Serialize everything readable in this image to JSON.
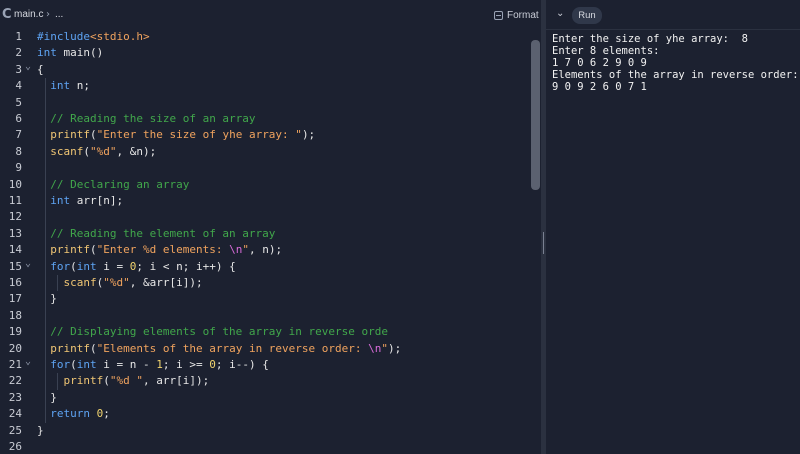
{
  "editor": {
    "file_name": "main.c",
    "crumb_separator": "›",
    "crumb_more": "...",
    "format_label": "Format",
    "lines": [
      {
        "n": "1",
        "fold": "",
        "tokens": [
          [
            "inc",
            "#include"
          ],
          [
            "hdr",
            "<stdio.h>"
          ]
        ]
      },
      {
        "n": "2",
        "fold": "",
        "tokens": [
          [
            "kw",
            "int"
          ],
          [
            "pl",
            " main()"
          ]
        ]
      },
      {
        "n": "3",
        "fold": "v",
        "tokens": [
          [
            "pl",
            "{"
          ]
        ]
      },
      {
        "n": "4",
        "fold": "",
        "tokens": [
          [
            "pl",
            "  "
          ],
          [
            "kw",
            "int"
          ],
          [
            "pl",
            " n;"
          ]
        ]
      },
      {
        "n": "5",
        "fold": "",
        "tokens": []
      },
      {
        "n": "6",
        "fold": "",
        "tokens": [
          [
            "pl",
            "  "
          ],
          [
            "cm",
            "// Reading the size of an array"
          ]
        ]
      },
      {
        "n": "7",
        "fold": "",
        "tokens": [
          [
            "pl",
            "  "
          ],
          [
            "fn",
            "printf"
          ],
          [
            "pl",
            "("
          ],
          [
            "str",
            "\"Enter the size of yhe array: \""
          ],
          [
            "pl",
            ");"
          ]
        ]
      },
      {
        "n": "8",
        "fold": "",
        "tokens": [
          [
            "pl",
            "  "
          ],
          [
            "fn",
            "scanf"
          ],
          [
            "pl",
            "("
          ],
          [
            "str",
            "\"%d\""
          ],
          [
            "pl",
            ", &n);"
          ]
        ]
      },
      {
        "n": "9",
        "fold": "",
        "tokens": []
      },
      {
        "n": "10",
        "fold": "",
        "tokens": [
          [
            "pl",
            "  "
          ],
          [
            "cm",
            "// Declaring an array"
          ]
        ]
      },
      {
        "n": "11",
        "fold": "",
        "tokens": [
          [
            "pl",
            "  "
          ],
          [
            "kw",
            "int"
          ],
          [
            "pl",
            " arr[n];"
          ]
        ]
      },
      {
        "n": "12",
        "fold": "",
        "tokens": []
      },
      {
        "n": "13",
        "fold": "",
        "tokens": [
          [
            "pl",
            "  "
          ],
          [
            "cm",
            "// Reading the element of an array"
          ]
        ]
      },
      {
        "n": "14",
        "fold": "",
        "tokens": [
          [
            "pl",
            "  "
          ],
          [
            "fn",
            "printf"
          ],
          [
            "pl",
            "("
          ],
          [
            "str",
            "\"Enter %d elements: "
          ],
          [
            "esc",
            "\\n"
          ],
          [
            "str",
            "\""
          ],
          [
            "pl",
            ", n);"
          ]
        ]
      },
      {
        "n": "15",
        "fold": "v",
        "tokens": [
          [
            "pl",
            "  "
          ],
          [
            "kw",
            "for"
          ],
          [
            "pl",
            "("
          ],
          [
            "kw",
            "int"
          ],
          [
            "pl",
            " i = "
          ],
          [
            "num",
            "0"
          ],
          [
            "pl",
            "; i < n; i++) {"
          ]
        ]
      },
      {
        "n": "16",
        "fold": "",
        "tokens": [
          [
            "pl",
            "    "
          ],
          [
            "fn",
            "scanf"
          ],
          [
            "pl",
            "("
          ],
          [
            "str",
            "\"%d\""
          ],
          [
            "pl",
            ", &arr[i]);"
          ]
        ]
      },
      {
        "n": "17",
        "fold": "",
        "tokens": [
          [
            "pl",
            "  }"
          ]
        ]
      },
      {
        "n": "18",
        "fold": "",
        "tokens": []
      },
      {
        "n": "19",
        "fold": "",
        "tokens": [
          [
            "pl",
            "  "
          ],
          [
            "cm",
            "// Displaying elements of the array in reverse orde"
          ]
        ]
      },
      {
        "n": "20",
        "fold": "",
        "tokens": [
          [
            "pl",
            "  "
          ],
          [
            "fn",
            "printf"
          ],
          [
            "pl",
            "("
          ],
          [
            "str",
            "\"Elements of the array in reverse order: "
          ],
          [
            "esc",
            "\\n"
          ],
          [
            "str",
            "\""
          ],
          [
            "pl",
            ");"
          ]
        ]
      },
      {
        "n": "21",
        "fold": "v",
        "tokens": [
          [
            "pl",
            "  "
          ],
          [
            "kw",
            "for"
          ],
          [
            "pl",
            "("
          ],
          [
            "kw",
            "int"
          ],
          [
            "pl",
            " i = n - "
          ],
          [
            "num",
            "1"
          ],
          [
            "pl",
            "; i >= "
          ],
          [
            "num",
            "0"
          ],
          [
            "pl",
            "; i--) {"
          ]
        ]
      },
      {
        "n": "22",
        "fold": "",
        "tokens": [
          [
            "pl",
            "    "
          ],
          [
            "fn",
            "printf"
          ],
          [
            "pl",
            "("
          ],
          [
            "str",
            "\"%d \""
          ],
          [
            "pl",
            ", arr[i]);"
          ]
        ]
      },
      {
        "n": "23",
        "fold": "",
        "tokens": [
          [
            "pl",
            "  }"
          ]
        ]
      },
      {
        "n": "24",
        "fold": "",
        "tokens": [
          [
            "pl",
            "  "
          ],
          [
            "kw",
            "return"
          ],
          [
            "pl",
            " "
          ],
          [
            "num",
            "0"
          ],
          [
            "pl",
            ";"
          ]
        ]
      },
      {
        "n": "25",
        "fold": "",
        "tokens": [
          [
            "pl",
            "}"
          ]
        ]
      },
      {
        "n": "26",
        "fold": "",
        "tokens": []
      }
    ]
  },
  "console": {
    "run_label": "Run",
    "output": "Enter the size of yhe array:  8\nEnter 8 elements:\n1 7 0 6 2 9 0 9\nElements of the array in reverse order:\n9 0 9 2 6 0 7 1"
  },
  "icons": {
    "lang": "c-language-icon",
    "format": "format-icon",
    "chevron": "chevron-down-icon"
  },
  "colors": {
    "background": "#1c2130",
    "keyword": "#5ea3f2",
    "string": "#f0a35e",
    "number": "#f0d36e",
    "function": "#f0c674",
    "comment": "#41a74b",
    "escape": "#d76bd8"
  }
}
